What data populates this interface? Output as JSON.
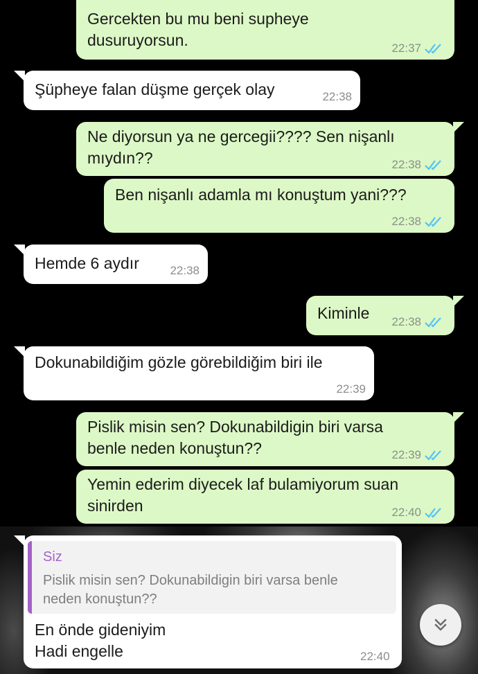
{
  "colors": {
    "outgoing_bubble": "#dcf8c6",
    "incoming_bubble": "#ffffff",
    "read_ticks": "#4fc3f7",
    "quote_accent": "#a463c8",
    "background": "#000000"
  },
  "messages": [
    {
      "text": "Gercekten bu mu beni supheye\ndusuruyorsun.",
      "time": "22:37",
      "ticks": "double-check-read-icon"
    },
    {
      "text": "Şüpheye falan düşme gerçek olay",
      "time": "22:38"
    },
    {
      "text": "Ne diyorsun ya ne gercegii???? Sen nişanlı\nmıydın??",
      "time": "22:38",
      "ticks": "double-check-read-icon"
    },
    {
      "text": "Ben nişanlı adamla mı konuştum yani???",
      "time": "22:38",
      "ticks": "double-check-read-icon"
    },
    {
      "text": "Hemde 6 aydır",
      "time": "22:38"
    },
    {
      "text": "Kiminle",
      "time": "22:38",
      "ticks": "double-check-read-icon"
    },
    {
      "text": "Dokunabildiğim gözle görebildiğim biri ile",
      "time": "22:39"
    },
    {
      "text": "Pislik misin sen? Dokunabildigin biri varsa\nbenle neden konuştun??",
      "time": "22:39",
      "ticks": "double-check-read-icon"
    },
    {
      "text": "Yemin ederim diyecek laf bulamiyorum suan\nsinirden",
      "time": "22:40",
      "ticks": "double-check-read-icon"
    },
    {
      "quote": {
        "author": "Siz",
        "text": "Pislik misin sen? Dokunabildigin biri varsa benle\nneden konuştun??"
      },
      "text": "En önde gideniyim\nHadi engelle",
      "time": "22:40"
    }
  ],
  "scroll_button": {
    "icon": "double-chevron-down-icon"
  }
}
